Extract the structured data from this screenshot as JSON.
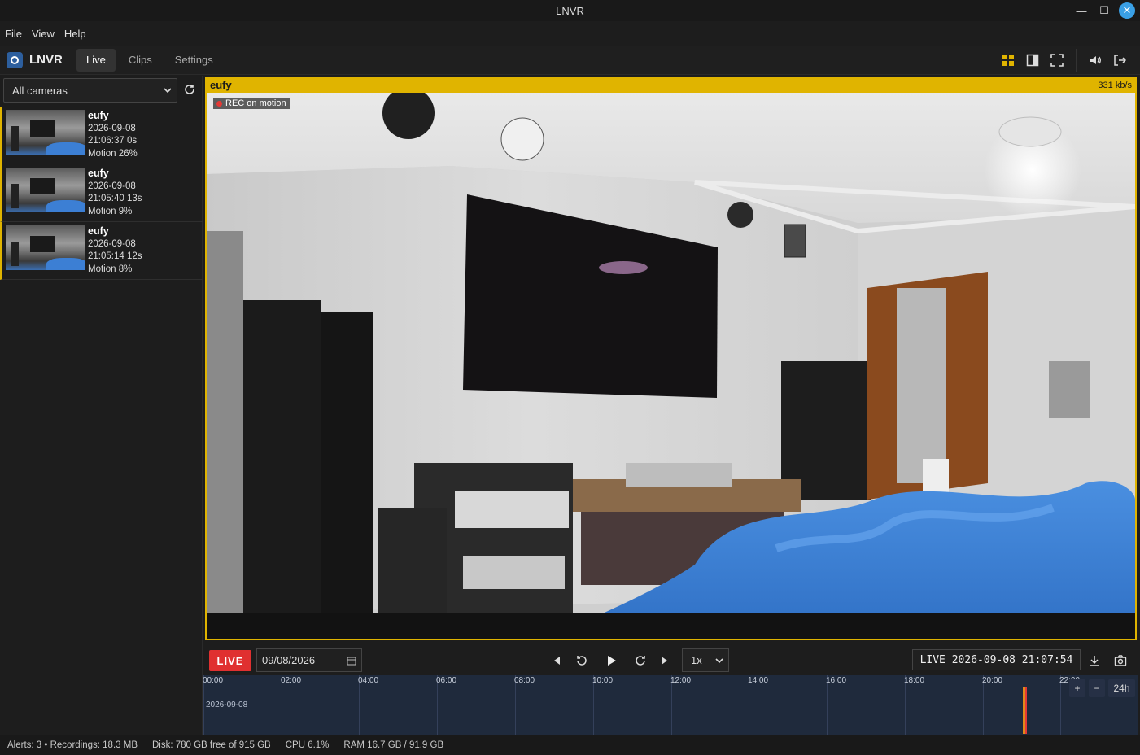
{
  "window": {
    "title": "LNVR"
  },
  "menu": [
    "File",
    "View",
    "Help"
  ],
  "app": {
    "name": "LNVR",
    "tabs": [
      "Live",
      "Clips",
      "Settings"
    ],
    "active_tab": "Live"
  },
  "sidebar": {
    "camera_filter": "All cameras",
    "events": [
      {
        "camera": "eufy",
        "date": "2026-09-08",
        "time": "21:06:37 0s",
        "motion": "Motion 26%"
      },
      {
        "camera": "eufy",
        "date": "2026-09-08",
        "time": "21:05:40 13s",
        "motion": "Motion 9%"
      },
      {
        "camera": "eufy",
        "date": "2026-09-08",
        "time": "21:05:14 12s",
        "motion": "Motion 8%"
      }
    ]
  },
  "view": {
    "camera_name": "eufy",
    "bitrate": "331 kb/s",
    "rec_status": "REC on motion",
    "accent": "#e0b400"
  },
  "controls": {
    "live_label": "LIVE",
    "date": "09/08/2026",
    "speed": "1x",
    "timestamp": "LIVE 2026-09-08 21:07:54"
  },
  "timeline": {
    "hours": [
      "00:00",
      "02:00",
      "04:00",
      "06:00",
      "08:00",
      "10:00",
      "12:00",
      "14:00",
      "16:00",
      "18:00",
      "20:00",
      "22:00"
    ],
    "day_label": "2026-09-08",
    "zoom_in": "+",
    "zoom_out": "−",
    "range": "24h"
  },
  "status": {
    "alerts": "Alerts: 3 • Recordings: 18.3 MB",
    "disk": "Disk: 780 GB free of 915 GB",
    "cpu": "CPU 6.1%",
    "ram": "RAM 16.7 GB / 91.9 GB"
  }
}
